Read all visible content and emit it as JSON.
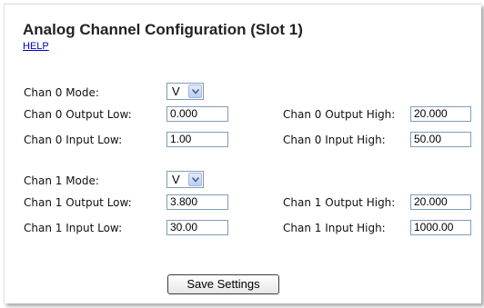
{
  "title": "Analog Channel Configuration (Slot 1)",
  "help_link": "HELP",
  "channels": [
    {
      "mode_label": "Chan 0 Mode:",
      "mode_value": "V",
      "output_low_label": "Chan 0 Output Low:",
      "output_low_value": "0.000",
      "output_high_label": "Chan 0 Output High:",
      "output_high_value": "20.000",
      "input_low_label": "Chan 0 Input Low:",
      "input_low_value": "1.00",
      "input_high_label": "Chan 0 Input High:",
      "input_high_value": "50.00"
    },
    {
      "mode_label": "Chan 1 Mode:",
      "mode_value": "V",
      "output_low_label": "Chan 1 Output Low:",
      "output_low_value": "3.800",
      "output_high_label": "Chan 1 Output High:",
      "output_high_value": "20.000",
      "input_low_label": "Chan 1 Input Low:",
      "input_low_value": "30.00",
      "input_high_label": "Chan 1 Input High:",
      "input_high_value": "1000.00"
    }
  ],
  "save_button": "Save Settings",
  "icons": {
    "dropdown": "chevron-down-icon"
  },
  "colors": {
    "link": "#0000cc",
    "input_border": "#7f9db9",
    "dropdown_button": "#b9cdf7"
  }
}
